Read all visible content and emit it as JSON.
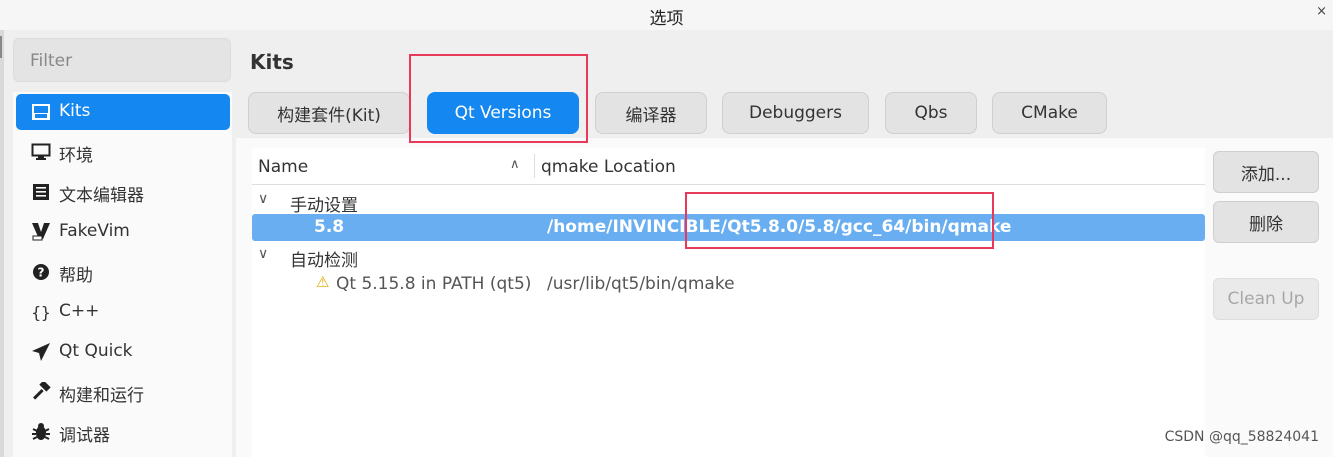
{
  "window": {
    "title": "选项"
  },
  "sidebar": {
    "filter_placeholder": "Filter",
    "items": [
      {
        "label": "Kits",
        "icon": "kits-icon",
        "active": true
      },
      {
        "label": "环境",
        "icon": "monitor-icon"
      },
      {
        "label": "文本编辑器",
        "icon": "text-editor-icon"
      },
      {
        "label": "FakeVim",
        "icon": "fakevim-icon"
      },
      {
        "label": "帮助",
        "icon": "help-icon"
      },
      {
        "label": "C++",
        "icon": "braces-icon"
      },
      {
        "label": "Qt Quick",
        "icon": "qt-quick-icon"
      },
      {
        "label": "构建和运行",
        "icon": "hammer-icon"
      },
      {
        "label": "调试器",
        "icon": "bug-icon"
      }
    ]
  },
  "main": {
    "heading": "Kits",
    "tabs": [
      {
        "label": "构建套件(Kit)"
      },
      {
        "label": "Qt Versions",
        "active": true
      },
      {
        "label": "编译器"
      },
      {
        "label": "Debuggers"
      },
      {
        "label": "Qbs"
      },
      {
        "label": "CMake"
      }
    ],
    "table": {
      "columns": [
        "Name",
        "qmake Location"
      ],
      "groups": [
        {
          "label": "手动设置",
          "rows": [
            {
              "name": "5.8",
              "location": "/home/INVINCIBLE/Qt5.8.0/5.8/gcc_64/bin/qmake",
              "selected": true
            }
          ]
        },
        {
          "label": "自动检测",
          "rows": [
            {
              "name": "Qt 5.15.8 in PATH (qt5)",
              "location": "/usr/lib/qt5/bin/qmake",
              "warning": true
            }
          ]
        }
      ]
    },
    "buttons": {
      "add": "添加...",
      "remove": "删除",
      "cleanup": "Clean Up"
    }
  },
  "watermark": "CSDN @qq_58824041",
  "colors": {
    "accent": "#1487f0",
    "selection": "#69aef0",
    "highlight_box": "#e8395a",
    "warning": "#e6a700"
  }
}
